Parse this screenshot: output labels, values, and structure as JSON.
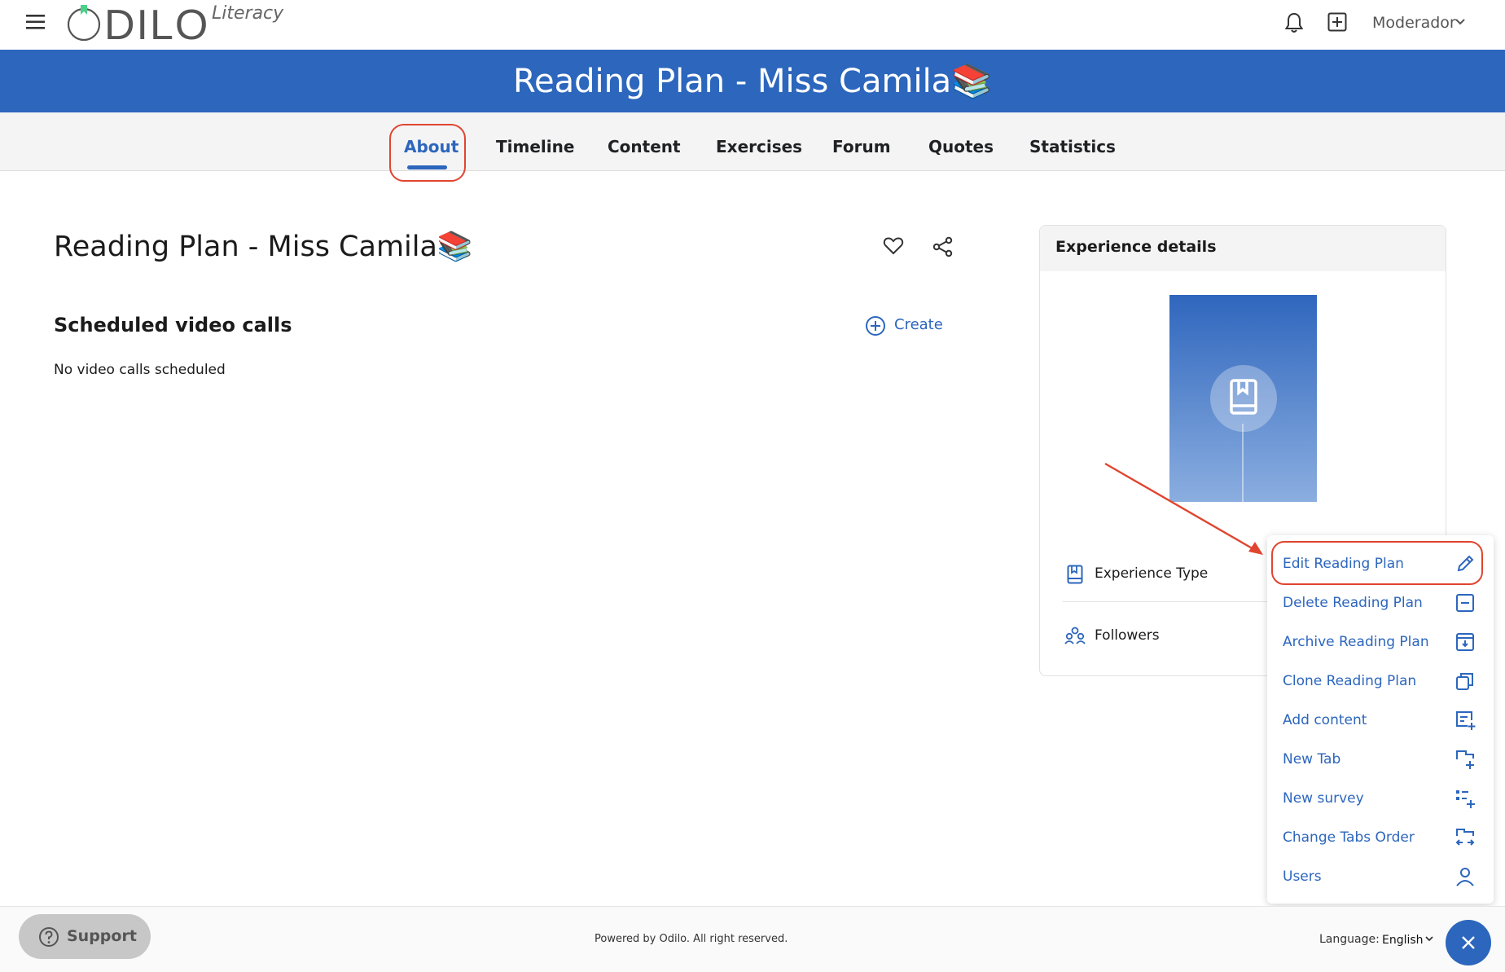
{
  "header": {
    "logo_text": "ODILO",
    "logo_sub": "Literacy",
    "user_label": "Moderador"
  },
  "banner": {
    "title": "Reading Plan - Miss Camila📚"
  },
  "tabs": [
    {
      "label": "About",
      "active": true
    },
    {
      "label": "Timeline"
    },
    {
      "label": "Content"
    },
    {
      "label": "Exercises"
    },
    {
      "label": "Forum"
    },
    {
      "label": "Quotes"
    },
    {
      "label": "Statistics"
    }
  ],
  "main": {
    "title": "Reading Plan - Miss Camila📚",
    "scheduled": {
      "title": "Scheduled video calls",
      "create_label": "Create",
      "empty_text": "No video calls scheduled"
    }
  },
  "details": {
    "title": "Experience details",
    "rows": [
      {
        "label": "Experience Type",
        "icon": "book-icon"
      },
      {
        "label": "Followers",
        "icon": "people-icon"
      }
    ]
  },
  "menu": {
    "items": [
      {
        "label": "Edit Reading Plan",
        "icon": "pencil-icon",
        "highlighted": true
      },
      {
        "label": "Delete Reading Plan",
        "icon": "minus-square-icon"
      },
      {
        "label": "Archive Reading Plan",
        "icon": "archive-icon"
      },
      {
        "label": "Clone Reading Plan",
        "icon": "copy-icon"
      },
      {
        "label": "Add content",
        "icon": "add-content-icon"
      },
      {
        "label": "New Tab",
        "icon": "new-tab-icon"
      },
      {
        "label": "New survey",
        "icon": "survey-icon"
      },
      {
        "label": "Change Tabs Order",
        "icon": "reorder-icon"
      },
      {
        "label": "Users",
        "icon": "user-icon"
      }
    ]
  },
  "footer": {
    "support_label": "Support",
    "powered": "Powered by Odilo. All right reserved.",
    "language_label": "Language:",
    "language_value": "English"
  },
  "colors": {
    "primary": "#2c66bd",
    "highlight": "#e0452f",
    "logo_accent": "#4cd08a"
  }
}
